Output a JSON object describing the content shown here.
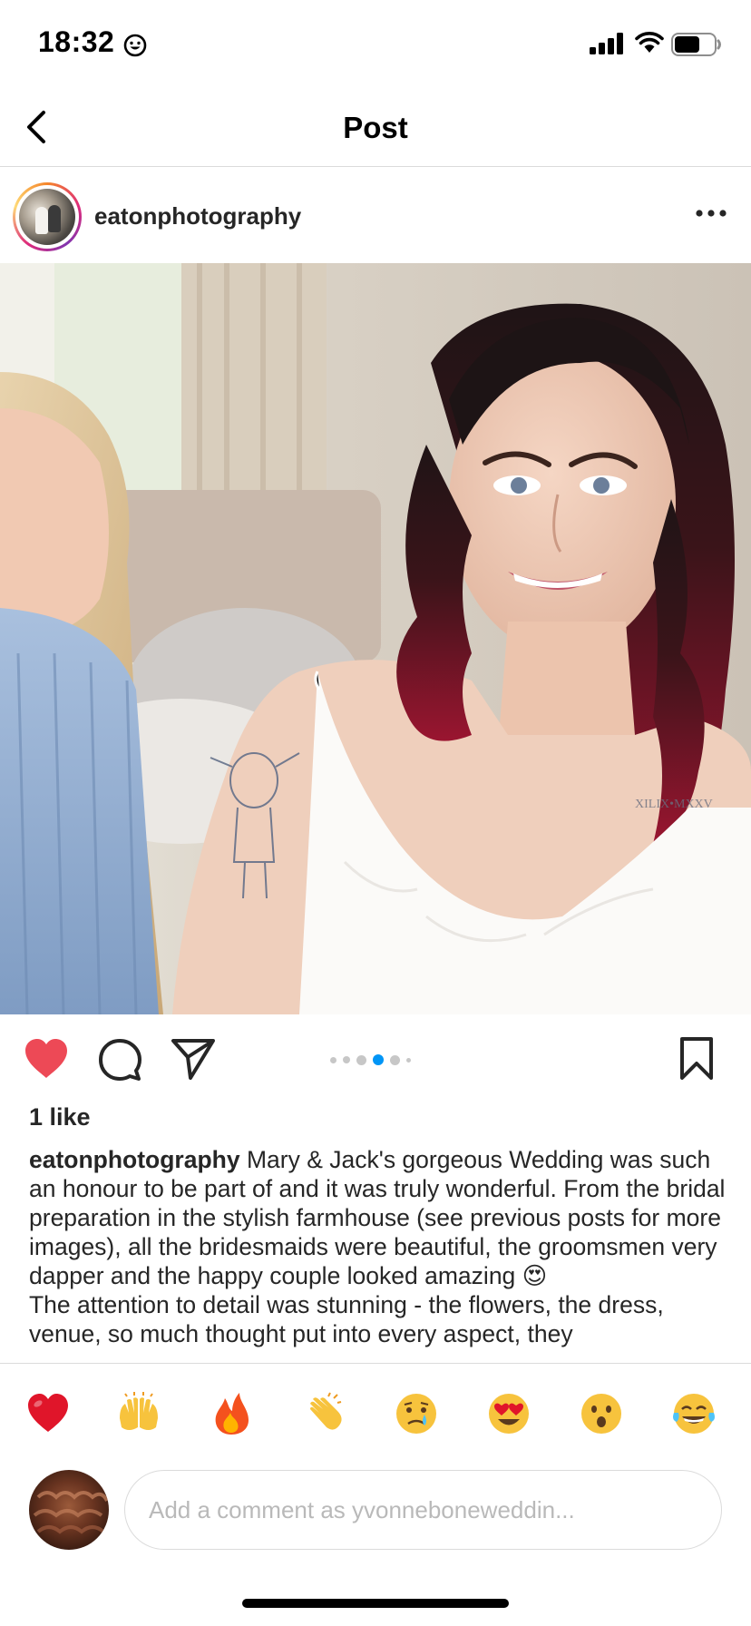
{
  "status_bar": {
    "time": "18:32",
    "status_emoji_icon": "smiley-face-icon",
    "signal_icon": "cellular-signal-icon",
    "wifi_icon": "wifi-icon",
    "battery_icon": "battery-icon",
    "battery_level": 0.65
  },
  "nav": {
    "back_icon": "chevron-left-icon",
    "title": "Post"
  },
  "post": {
    "username": "eatonphotography",
    "more_icon": "ellipsis-horizontal-icon",
    "image_icon": "wedding-photo-bride-and-bridesmaid",
    "carousel": {
      "total_dots": 6,
      "active_index": 3
    },
    "actions": {
      "like_icon": "heart-filled-icon",
      "comment_icon": "comment-bubble-icon",
      "share_icon": "paper-plane-icon",
      "save_icon": "bookmark-icon",
      "like_color": "#ed4956"
    },
    "likes": "1 like",
    "caption": {
      "user": "eatonphotography",
      "paragraph_1": "Mary & Jack's gorgeous Wedding was such an honour to be part of and it was truly wonderful. From the bridal preparation in the stylish farmhouse (see previous posts for more images), all the bridesmaids were beautiful, the groomsmen very dapper and the happy couple looked amazing 😍",
      "paragraph_2": "The attention to detail was stunning - the flowers, the dress, venue, so much thought put into every aspect, they"
    }
  },
  "quick_reactions": [
    "❤️",
    "🙌",
    "🔥",
    "👏",
    "😢",
    "😍",
    "😮",
    "😂"
  ],
  "comment": {
    "avatar_icon": "user-avatar-icon",
    "placeholder": "Add a comment as yvonneboneweddin..."
  },
  "colors": {
    "accent_blue": "#0095f6",
    "divider": "#dbdbdb",
    "text_primary": "#262626",
    "placeholder": "#b9b9b9"
  }
}
